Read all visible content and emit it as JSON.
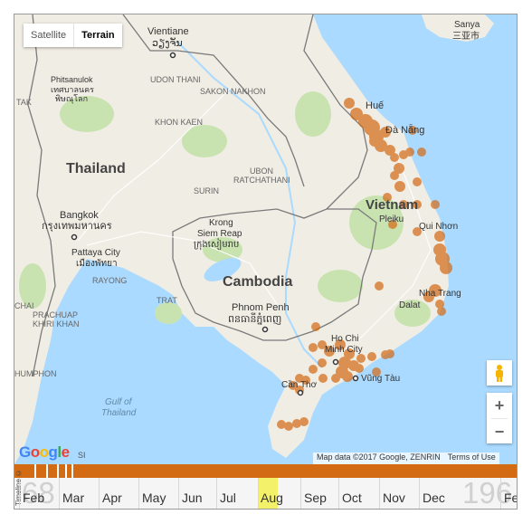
{
  "map": {
    "maptype": {
      "satellite": "Satellite",
      "terrain": "Terrain"
    },
    "labels": {
      "vientiane": "Vientiane",
      "vientiane_local": "ວຽງຈັນ",
      "sanya": "Sanya",
      "sanya_local": "三亚市",
      "phitsanulok": "Phitsanulok",
      "phitsanulok_local1": "เทศบาลนคร",
      "phitsanulok_local2": "พิษณุโลก",
      "udon": "UDON THANI",
      "sakon": "SAKON NAKHON",
      "khon_kaen": "KHON KAEN",
      "thailand": "Thailand",
      "ubon1": "UBON",
      "ubon2": "RATCHATHANI",
      "surin": "SURIN",
      "bangkok": "Bangkok",
      "bangkok_local": "กรุงเทพมหานคร",
      "pattaya": "Pattaya City",
      "pattaya_local": "เมืองพัทยา",
      "rayong": "RAYONG",
      "krong": "Krong",
      "siem_reap": "Siem Reap",
      "siem_reap_local": "ក្រុងសៀមរាប",
      "cambodia": "Cambodia",
      "trat": "TRAT",
      "phnom_penh": "Phnom Penh",
      "phnom_penh_local": "ពនធានីភ្នំពេញ",
      "hue": "Huế",
      "da_nang": "Đà Nẵng",
      "vietnam": "Vietnam",
      "pleiku": "Pleiku",
      "qui_nhon": "Qui Nhơn",
      "nha_trang": "Nha Trang",
      "dalat": "Dalat",
      "ho_chi_minh1": "Ho Chi",
      "ho_chi_minh2": "Minh City",
      "vung_tau": "Vũng Tàu",
      "can_tho": "Cần Thơ",
      "gulf1": "Gulf of",
      "gulf2": "Thailand",
      "prachuap1": "PRACHUAP",
      "prachuap2": "KHIRI KHAN",
      "chumphon": "HUMPHON",
      "tak": "TAK",
      "chai": "CHAI"
    },
    "marker_color": "#d36a14",
    "zoom_in": "+",
    "zoom_out": "−",
    "attribution": "Map data ©2017 Google, ZENRIN",
    "terms": "Terms of Use",
    "google_logo": "Google",
    "google_si": "SI"
  },
  "timeline": {
    "vertical_label": "Timeline ©",
    "year_left": "68",
    "year_right": "196",
    "months": [
      "Feb",
      "Mar",
      "Apr",
      "May",
      "Jun",
      "Jul",
      "Aug",
      "Sep",
      "Oct",
      "Nov",
      "Dec",
      "Fe"
    ],
    "highlighted_month": "Aug",
    "bar_color": "#d36a14"
  }
}
